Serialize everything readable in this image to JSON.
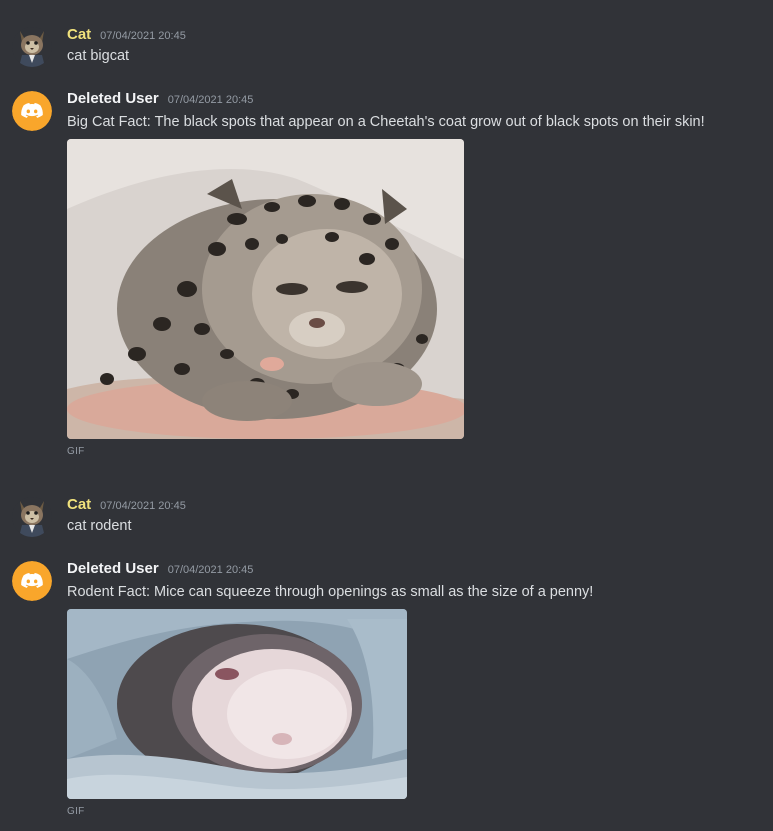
{
  "colors": {
    "background": "#313338",
    "cat_username": "#f0e27c",
    "deleted_username": "#f2f3f5",
    "timestamp": "#949ba4",
    "discord_avatar_bg": "#f9a62b"
  },
  "messages": [
    {
      "username": "Cat",
      "avatar_icon": "cat-avatar-icon",
      "timestamp": "07/04/2021 20:45",
      "text": "cat bigcat"
    },
    {
      "username": "Deleted User",
      "avatar_icon": "discord-logo-icon",
      "timestamp": "07/04/2021 20:45",
      "text": "Big Cat Fact: The black spots that appear on a Cheetah's coat grow out of black spots on their skin!",
      "attachment": {
        "kind_label": "GIF"
      }
    },
    {
      "username": "Cat",
      "avatar_icon": "cat-avatar-icon",
      "timestamp": "07/04/2021 20:45",
      "text": "cat rodent"
    },
    {
      "username": "Deleted User",
      "avatar_icon": "discord-logo-icon",
      "timestamp": "07/04/2021 20:45",
      "text": "Rodent Fact: Mice can squeeze through openings as small as the size of a penny!",
      "attachment": {
        "kind_label": "GIF"
      }
    }
  ]
}
